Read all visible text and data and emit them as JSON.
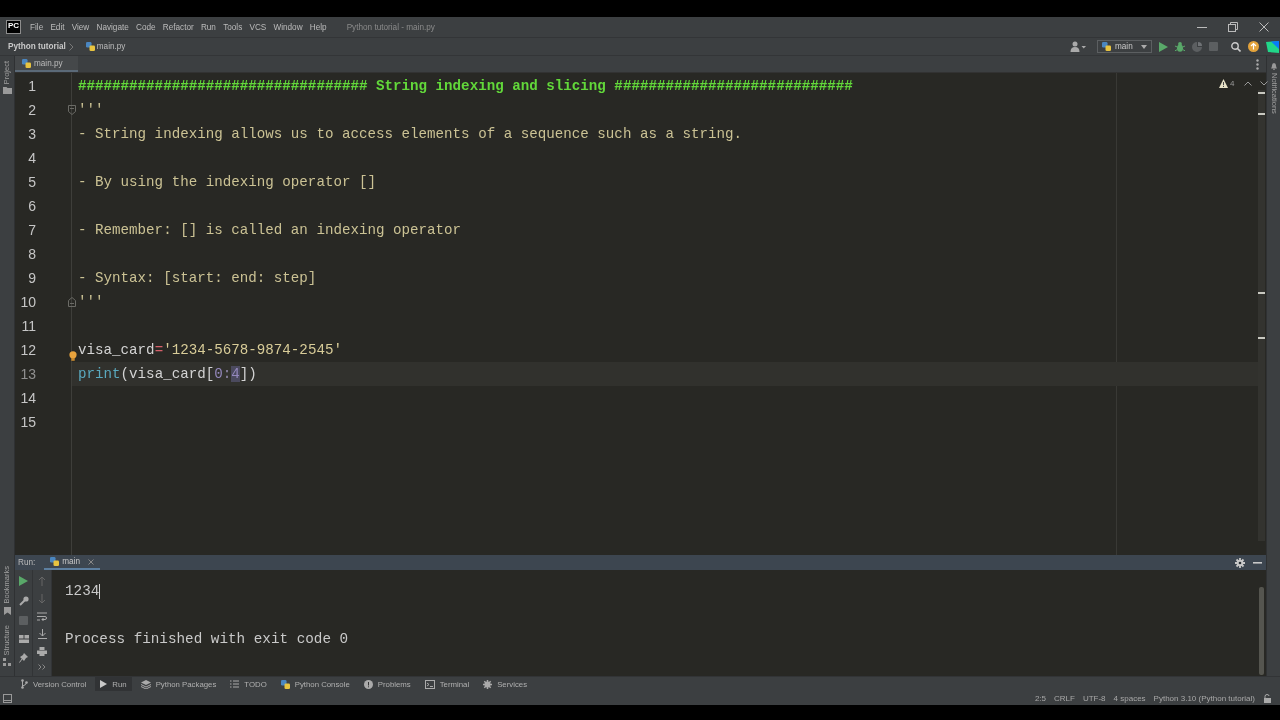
{
  "title_bar": {
    "logo": "PC",
    "menu": [
      "File",
      "Edit",
      "View",
      "Navigate",
      "Code",
      "Refactor",
      "Run",
      "Tools",
      "VCS",
      "Window",
      "Help"
    ],
    "window_title": "Python tutorial - main.py"
  },
  "navigation_bar": {
    "breadcrumbs": [
      {
        "kind": "project",
        "label": "Python tutorial"
      },
      {
        "kind": "file",
        "label": "main.py"
      }
    ],
    "run_configuration": "main"
  },
  "left_tool_strip": {
    "top": [
      {
        "kind": "project",
        "label": "Project"
      }
    ],
    "bottom": [
      {
        "kind": "bookmarks",
        "label": "Bookmarks"
      },
      {
        "kind": "structure",
        "label": "Structure"
      }
    ]
  },
  "editor": {
    "tabs": [
      {
        "label": "main.py",
        "selected": true
      }
    ],
    "warning_count": "4",
    "lines": [
      {
        "number": "1",
        "current": false,
        "fold_start": false,
        "fold_end": false,
        "bulb": false,
        "tokens": [
          {
            "kind": "comment",
            "text": "################################## String indexing and slicing ############################",
            "highlighted": false
          }
        ]
      },
      {
        "number": "2",
        "current": false,
        "fold_start": true,
        "fold_end": false,
        "bulb": false,
        "tokens": [
          {
            "kind": "docstring",
            "text": "'''",
            "highlighted": false
          }
        ]
      },
      {
        "number": "3",
        "current": false,
        "fold_start": false,
        "fold_end": false,
        "bulb": false,
        "tokens": [
          {
            "kind": "docstring",
            "text": "- String indexing allows us to access elements of a sequence such as a string.",
            "highlighted": false
          }
        ]
      },
      {
        "number": "4",
        "current": false,
        "fold_start": false,
        "fold_end": false,
        "bulb": false
      },
      {
        "number": "5",
        "current": false,
        "fold_start": false,
        "fold_end": false,
        "bulb": false,
        "tokens": [
          {
            "kind": "docstring",
            "text": "- By using the indexing operator []",
            "highlighted": false
          }
        ]
      },
      {
        "number": "6",
        "current": false,
        "fold_start": false,
        "fold_end": false,
        "bulb": false
      },
      {
        "number": "7",
        "current": false,
        "fold_start": false,
        "fold_end": false,
        "bulb": false,
        "tokens": [
          {
            "kind": "docstring",
            "text": "- Remember: [] is called an indexing operator",
            "highlighted": false
          }
        ]
      },
      {
        "number": "8",
        "current": false,
        "fold_start": false,
        "fold_end": false,
        "bulb": false
      },
      {
        "number": "9",
        "current": false,
        "fold_start": false,
        "fold_end": false,
        "bulb": false,
        "tokens": [
          {
            "kind": "docstring",
            "text": "- Syntax: [start: end: step]",
            "highlighted": false
          }
        ]
      },
      {
        "number": "10",
        "current": false,
        "fold_start": false,
        "fold_end": true,
        "bulb": false,
        "tokens": [
          {
            "kind": "docstring",
            "text": "'''",
            "highlighted": false
          }
        ]
      },
      {
        "number": "11",
        "current": false,
        "fold_start": false,
        "fold_end": false,
        "bulb": false
      },
      {
        "number": "12",
        "current": false,
        "fold_start": false,
        "fold_end": false,
        "bulb": true,
        "tokens": [
          {
            "kind": "name",
            "text": "visa_card",
            "highlighted": false
          },
          {
            "kind": "operator",
            "text": "=",
            "highlighted": false
          },
          {
            "kind": "string",
            "text": "'1234-5678-9874-2545'",
            "highlighted": false
          }
        ]
      },
      {
        "number": "13",
        "current": true,
        "fold_start": false,
        "fold_end": false,
        "bulb": false,
        "tokens": [
          {
            "kind": "builtin",
            "text": "print",
            "highlighted": false
          },
          {
            "kind": "bracket",
            "text": "(",
            "highlighted": false
          },
          {
            "kind": "name",
            "text": "visa_card",
            "highlighted": false
          },
          {
            "kind": "bracket",
            "text": "[",
            "highlighted": false
          },
          {
            "kind": "number",
            "text": "0",
            "highlighted": false
          },
          {
            "kind": "colon",
            "text": ":",
            "highlighted": false
          },
          {
            "kind": "number",
            "text": "4",
            "highlighted": true
          },
          {
            "kind": "bracket",
            "text": "])",
            "highlighted": false
          }
        ]
      },
      {
        "number": "14",
        "current": false,
        "fold_start": false,
        "fold_end": false,
        "bulb": false
      },
      {
        "number": "15",
        "current": false,
        "fold_start": false,
        "fold_end": false,
        "bulb": false
      }
    ]
  },
  "right_tool_strip": [
    {
      "kind": "notifications",
      "label": "Notifications"
    }
  ],
  "run_panel": {
    "label": "Run:",
    "tabs": [
      {
        "label": "main",
        "selected": true
      }
    ],
    "output": [
      {
        "kind": "stdout",
        "text": "1234",
        "caret": true
      },
      {
        "kind": "system",
        "text": "Process finished with exit code 0",
        "caret": false
      }
    ]
  },
  "tool_window_bar": [
    {
      "kind": "vcs",
      "label": "Version Control",
      "selected": false
    },
    {
      "kind": "run",
      "label": "Run",
      "selected": true
    },
    {
      "kind": "packages",
      "label": "Python Packages",
      "selected": false
    },
    {
      "kind": "todo",
      "label": "TODO",
      "selected": false
    },
    {
      "kind": "console",
      "label": "Python Console",
      "selected": false
    },
    {
      "kind": "problems",
      "label": "Problems",
      "selected": false
    },
    {
      "kind": "terminal",
      "label": "Terminal",
      "selected": false
    },
    {
      "kind": "services",
      "label": "Services",
      "selected": false
    }
  ],
  "status_bar": [
    "2:5",
    "CRLF",
    "UTF-8",
    "4 spaces",
    "Python 3.10 (Python tutorial)"
  ]
}
